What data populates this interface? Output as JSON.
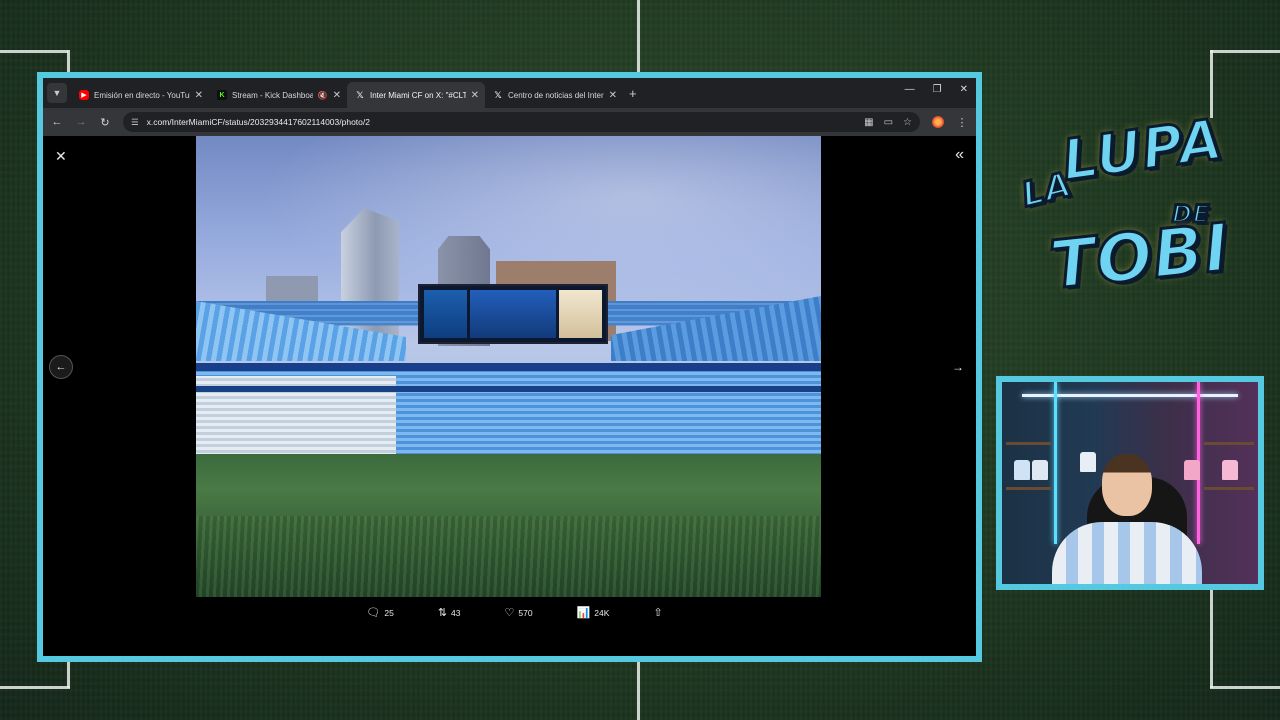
{
  "browser": {
    "tabs": [
      {
        "title": "Emisión en directo - YouTube S",
        "favicon": "youtube-icon",
        "active": false
      },
      {
        "title": "Stream - Kick Dashboard",
        "favicon": "kick-icon",
        "active": false,
        "muted": true
      },
      {
        "title": "Inter Miami CF on X: \"#CLTvMI\"",
        "favicon": "x-icon",
        "active": true
      },
      {
        "title": "Centro de noticias del Inter Mi",
        "favicon": "x-icon",
        "active": false
      }
    ],
    "url": "x.com/InterMiamiCF/status/2032934417602114003/photo/2"
  },
  "post": {
    "actions": {
      "replies": "25",
      "reposts": "43",
      "likes": "570",
      "views": "24K"
    }
  },
  "overlay": {
    "logo_lines": [
      "LA",
      "LUPA",
      "DE",
      "TOBI"
    ]
  },
  "colors": {
    "frame_accent": "#55c9e0",
    "pitch": "#203a22"
  }
}
